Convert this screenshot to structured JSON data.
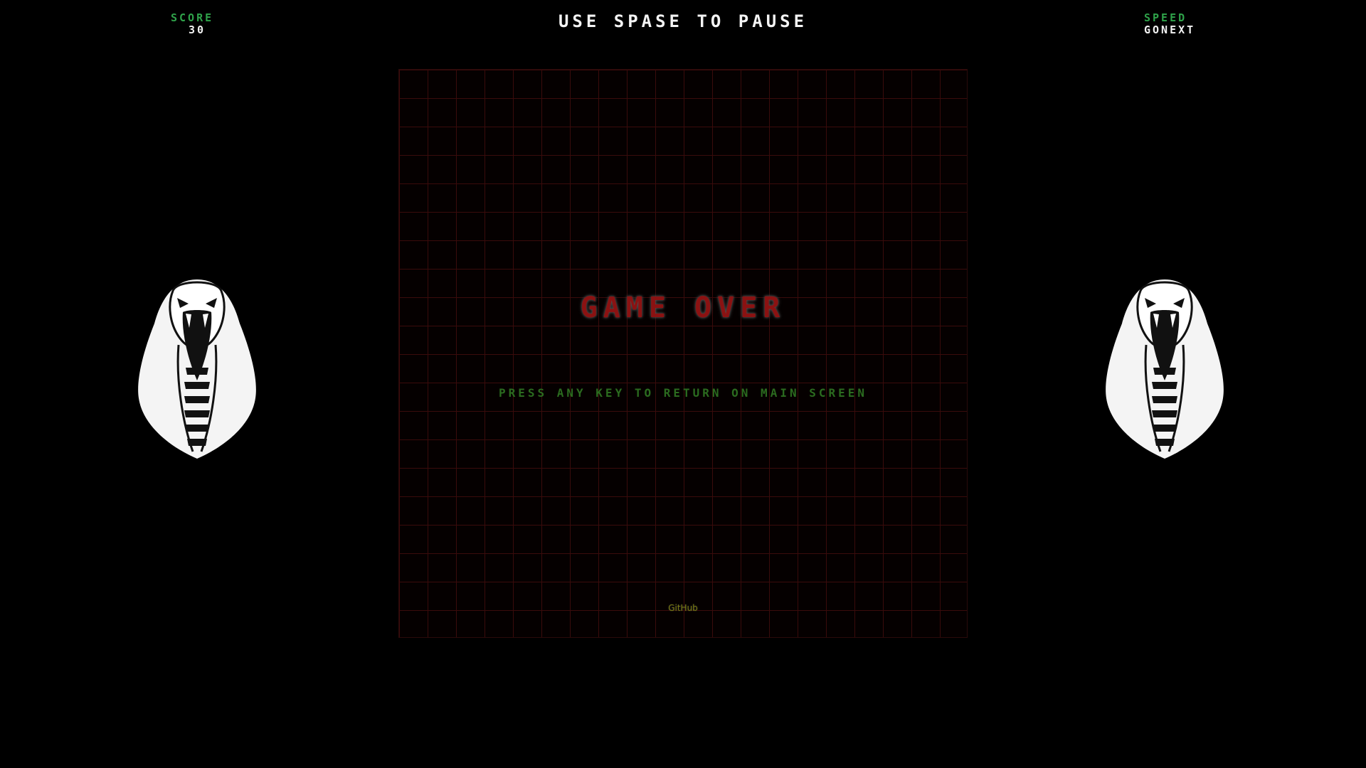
{
  "hud": {
    "score_label": "SCORE",
    "score_value": "30",
    "speed_label": "SPEED",
    "speed_value": "GONEXT",
    "pause_hint": "USE SPASE TO PAUSE"
  },
  "board": {
    "columns": 20,
    "rows": 20
  },
  "overlay": {
    "game_over": "GAME OVER",
    "press_key": "PRESS ANY KEY TO RETURN ON MAIN SCREEN"
  },
  "footer": {
    "github_label": "GitHub"
  },
  "decorations": {
    "left_icon": "cobra-icon",
    "right_icon": "cobra-icon"
  },
  "colors": {
    "background": "#000000",
    "label_green": "#2fa34a",
    "grid_line": "#3a0b0b",
    "game_over_red": "#8b1212",
    "prompt_green": "#2b6b1f",
    "link_yellow": "#7a7a12"
  }
}
